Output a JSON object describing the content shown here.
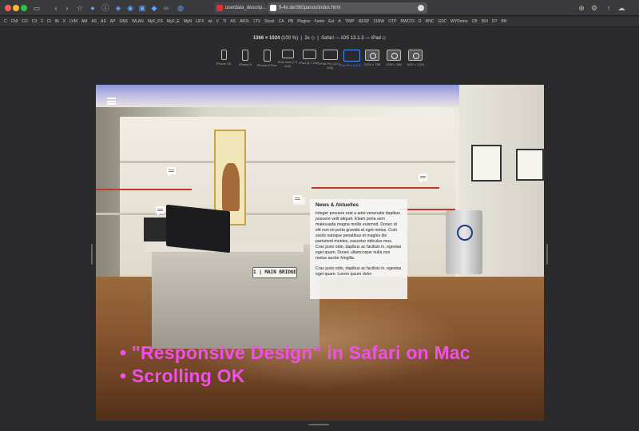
{
  "browser": {
    "tabs": [
      {
        "label": "userdata_descrip..."
      },
      {
        "label": "9-4x.de/360panos/index.html"
      }
    ],
    "bookmarks": [
      "C",
      "CNI",
      "CO",
      "C3",
      "2",
      "Cl",
      "IN",
      "X",
      "LVM",
      "AM",
      "AS",
      "AS",
      "AP",
      "GM1",
      "WLAN",
      "MyF_PS",
      "MyF_E",
      "MyN",
      "LIFX",
      "wt",
      "V",
      "TI",
      "AS",
      "ARJL",
      "LTV",
      "Stock",
      "CA",
      "PB",
      "Plugins",
      "Fonts",
      "Ext",
      "A",
      "TIMP",
      "RESP",
      "21RW",
      "OTP",
      "RWC23",
      "D",
      "RNC",
      "GSC",
      "WYDemo",
      "CB",
      "360",
      "DT",
      "BN"
    ]
  },
  "responsive": {
    "resolution": "1366 × 1024",
    "zoom_pct": "(100 %)",
    "scale": "2x ◇",
    "agent": "Safari — iOS 13.1.3 — iPad ◇",
    "devices": [
      {
        "label": "iPhone SE"
      },
      {
        "label": "iPhone 8"
      },
      {
        "label": "iPhone 8 Plus"
      },
      {
        "label": "iPad mini (7,9 Zoll)"
      },
      {
        "label": "iPad (9,7 Zoll)"
      },
      {
        "label": "iPad Pro (10,5 Zoll)"
      },
      {
        "label": "iPad Pro (12,9...",
        "active": true
      },
      {
        "label": "1024 × 768"
      },
      {
        "label": "1280 × 960"
      },
      {
        "label": "1920 × 1024"
      }
    ]
  },
  "viewport": {
    "sign": "1 | MAIN BRIDGE",
    "popup": {
      "title": "News & Aktuelles",
      "p1": "Integer posuere erat a ante venenatis dapibus posuere velit aliquet. Etiam porta sem malesuada magna mollis euismod. Donec id elit non mi porta gravida at eget metus. Cum sociis natoque penatibus et magnis dis parturient montes, nascetur ridiculus mus. Cras justo odio, dapibus ac facilisis in, egestas eget quam. Donec ullamcorper nulla non metus auctor fringilla.",
      "p2": "Cras justo odio, dapibus ac facilisis in, egestas eget quam. Lorem ipsum dolor"
    },
    "headline_1": "• \"Responsive Design\" in Safari on  Mac",
    "headline_2": "• Scrolling OK"
  },
  "colors": {
    "headline": "#f04fe8",
    "active_device": "#4b8ff5"
  }
}
